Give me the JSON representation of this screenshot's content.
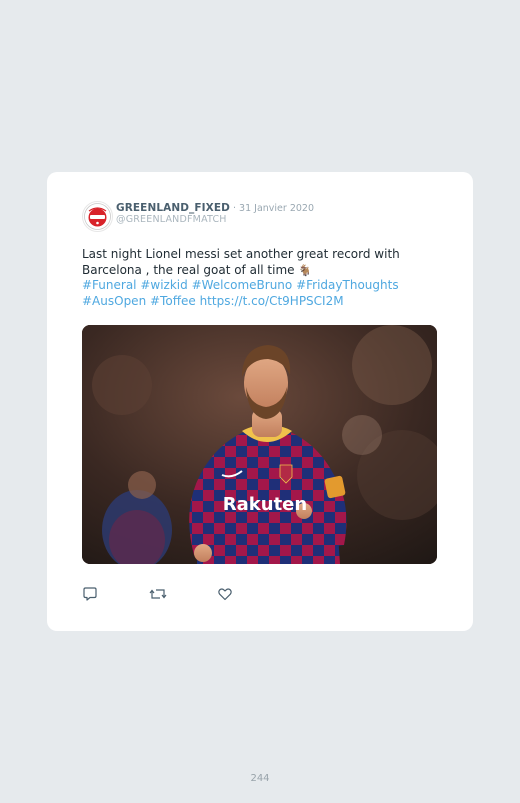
{
  "tweet": {
    "author_name": "GREENLAND_FIXED",
    "separator": " · ",
    "date": "31 Janvier 2020",
    "handle": "@GREENLANDFMATCH",
    "text_line1": "Last night Lionel messi set another great record with",
    "text_line2": "Barcelona , the real goat of all time",
    "goat_emoji": "🐐",
    "hashtags_line3": [
      "#Funeral",
      "#wizkid",
      "#WelcomeBruno",
      "#FridayThoughts"
    ],
    "hashtags_line4": [
      "#AusOpen",
      "#Toffee"
    ],
    "link": "https://t.co/Ct9HPSCI2M",
    "photo": {
      "jersey_sponsor": "Rakuten"
    }
  },
  "actions": {
    "reply_icon": "reply-icon",
    "retweet_icon": "retweet-icon",
    "like_icon": "heart-icon"
  },
  "colors": {
    "background": "#e6eaed",
    "card": "#ffffff",
    "hashtag": "#4fa8e0",
    "name": "#4a5f6e",
    "meta": "#9aa8b2"
  },
  "page": {
    "number": "244"
  }
}
